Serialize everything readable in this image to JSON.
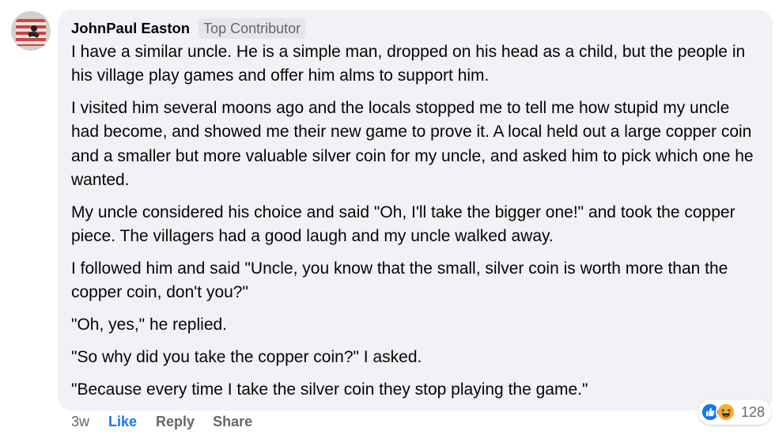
{
  "comment": {
    "author": "JohnPaul Easton",
    "badge": "Top Contributor",
    "paragraphs": [
      "I have a similar uncle. He is a simple man, dropped on his head as a child, but the people in his village play games and offer him alms to support him.",
      "I visited him several moons ago and the locals stopped me to tell me how stupid my uncle had become, and showed me their new game to prove it. A local held out a large copper coin and a smaller but more valuable silver coin for my uncle, and asked him to pick which one he wanted.",
      "My uncle considered his choice and said \"Oh, I'll take the bigger one!\" and took the copper piece. The villagers had a good laugh and my uncle walked away.",
      "I followed him and said \"Uncle, you know that the small, silver coin is worth more than the copper coin, don't you?\"",
      "\"Oh, yes,\" he replied.",
      "\"So why did you take the copper coin?\" I asked.",
      "\"Because every time I take the silver coin they stop playing the game.\""
    ]
  },
  "actions": {
    "time": "3w",
    "like": "Like",
    "reply": "Reply",
    "share": "Share"
  },
  "reactions": {
    "icons": [
      "like-icon",
      "haha-icon"
    ],
    "count": "128"
  },
  "colors": {
    "bubble": "#f0f2f5",
    "like_blue": "#1877f2",
    "secondary_text": "#65676b",
    "haha_yellow": "#f7b125"
  }
}
